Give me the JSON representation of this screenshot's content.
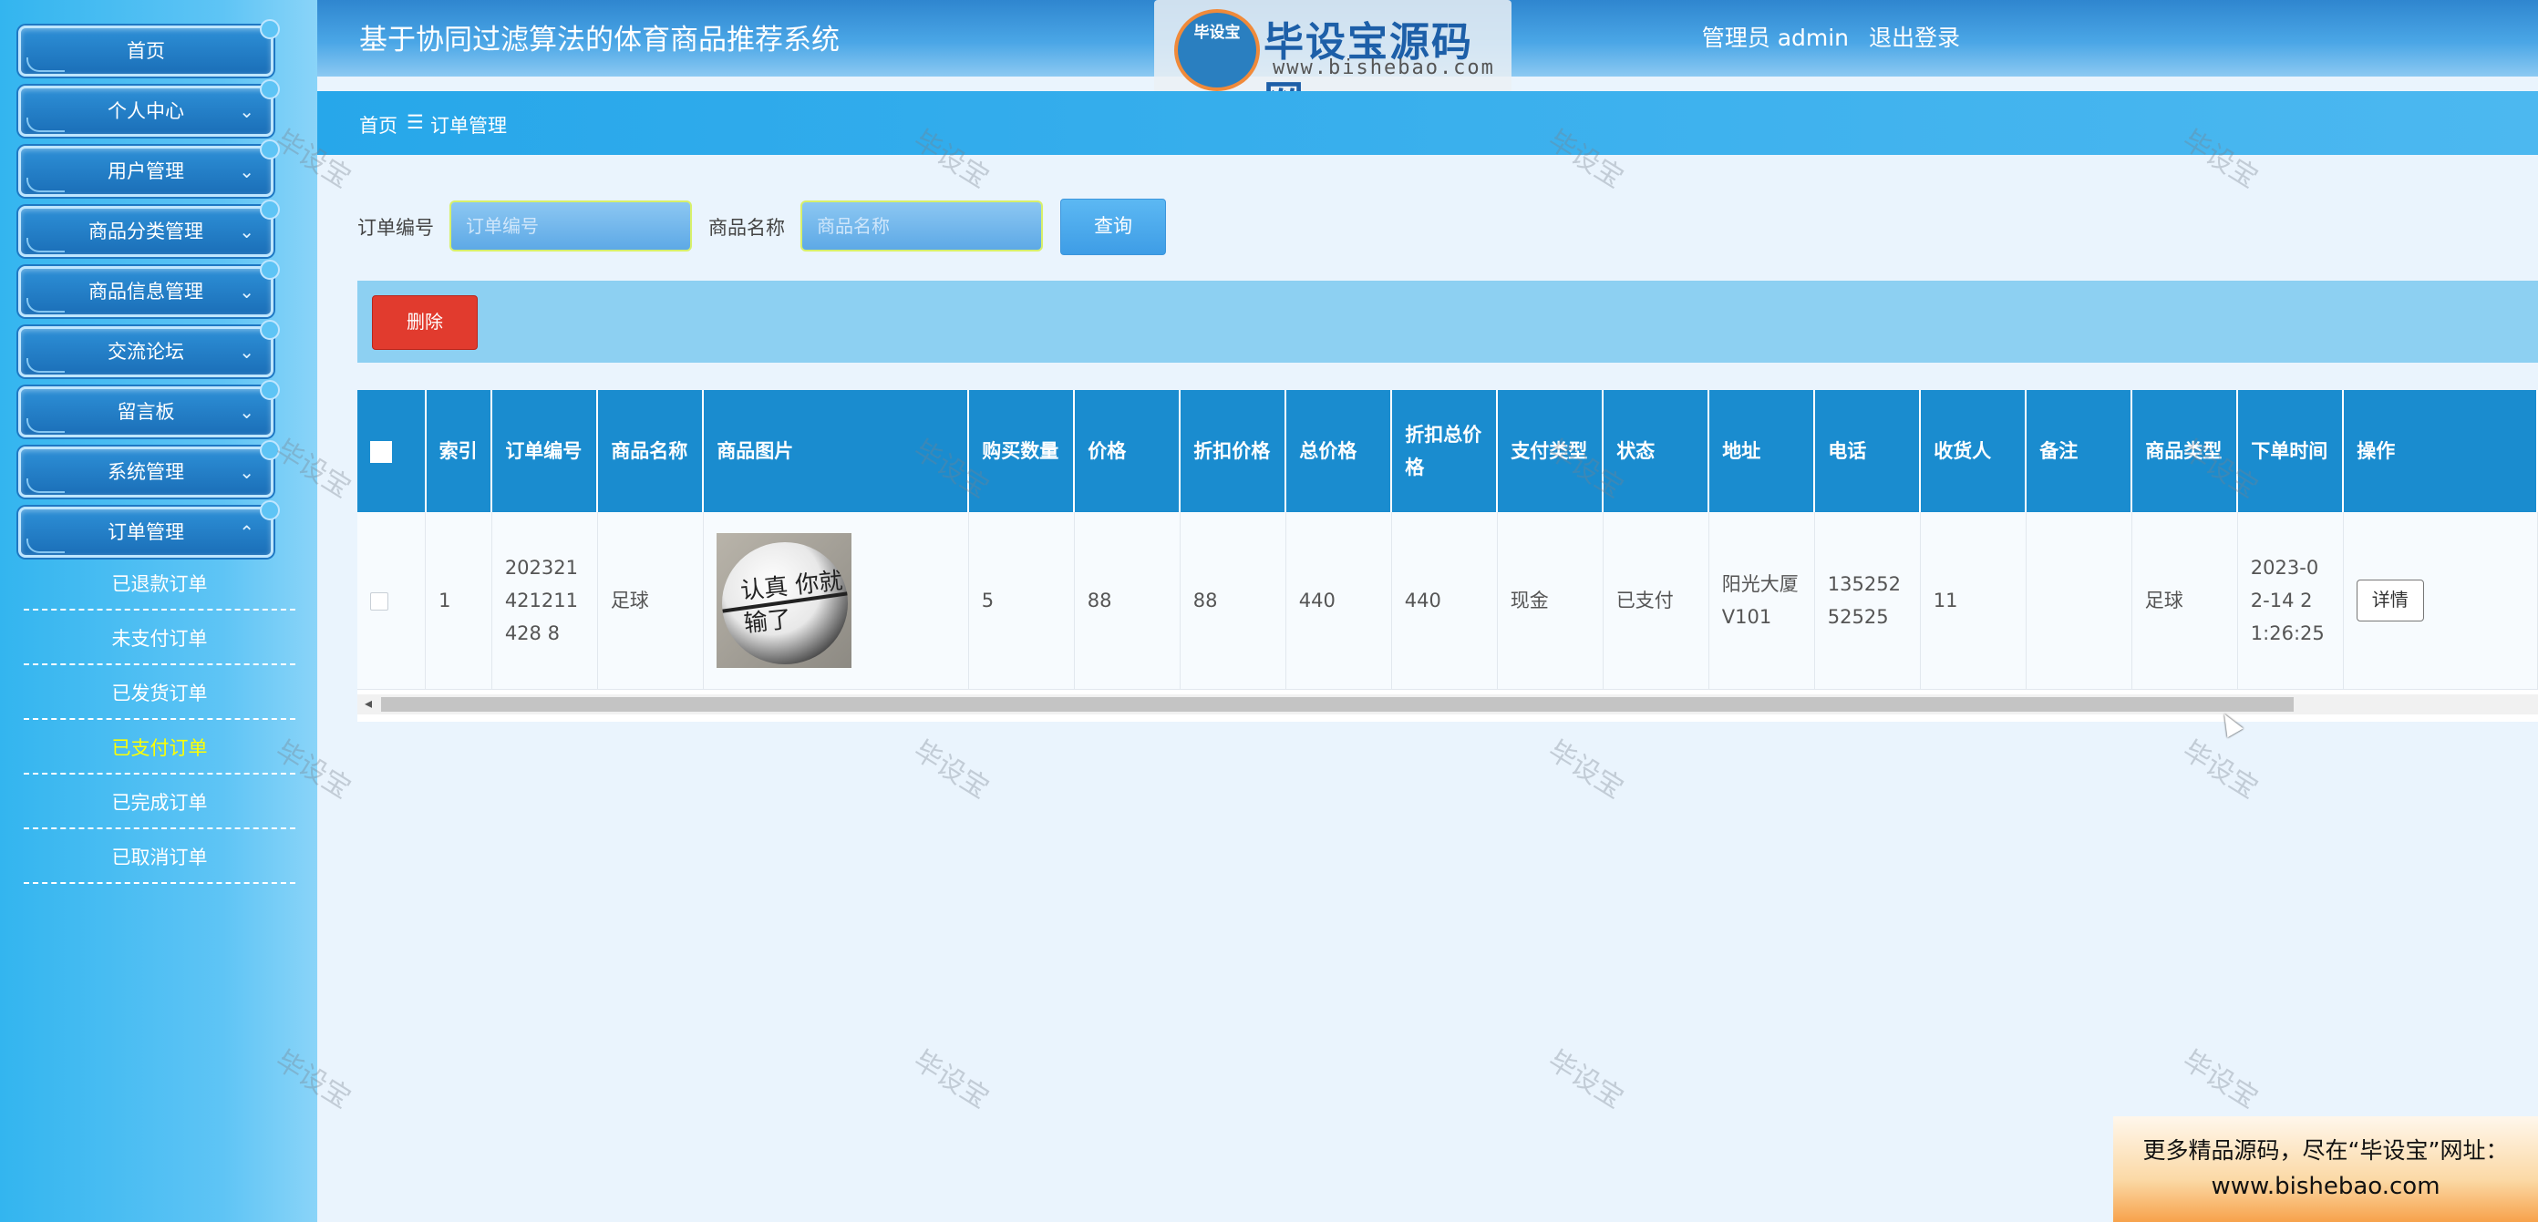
{
  "header": {
    "title": "基于协同过滤算法的体育商品推荐系统",
    "user_role": "管理员 admin",
    "logout": "退出登录"
  },
  "logo": {
    "mascot_text": "毕设宝",
    "brand": "毕设宝源码网",
    "url": "www.bishebao.com"
  },
  "sidebar": {
    "menus": [
      {
        "label": "首页"
      },
      {
        "label": "个人中心"
      },
      {
        "label": "用户管理"
      },
      {
        "label": "商品分类管理"
      },
      {
        "label": "商品信息管理"
      },
      {
        "label": "交流论坛"
      },
      {
        "label": "留言板"
      },
      {
        "label": "系统管理"
      },
      {
        "label": "订单管理"
      }
    ],
    "order_sub": [
      {
        "label": "已退款订单"
      },
      {
        "label": "未支付订单"
      },
      {
        "label": "已发货订单"
      },
      {
        "label": "已支付订单",
        "active": true
      },
      {
        "label": "已完成订单"
      },
      {
        "label": "已取消订单"
      }
    ]
  },
  "breadcrumb": {
    "home": "首页",
    "sep": "☰",
    "current": "订单管理"
  },
  "search": {
    "order_no_label": "订单编号",
    "order_no_placeholder": "订单编号",
    "goods_name_label": "商品名称",
    "goods_name_placeholder": "商品名称",
    "query_button": "查询"
  },
  "actions": {
    "delete_button": "删除"
  },
  "table": {
    "columns": [
      "索引",
      "订单编号",
      "商品名称",
      "商品图片",
      "购买数量",
      "价格",
      "折扣价格",
      "总价格",
      "折扣总价格",
      "支付类型",
      "状态",
      "地址",
      "电话",
      "收货人",
      "备注",
      "商品类型",
      "下单时间",
      "操作"
    ],
    "rows": [
      {
        "index": "1",
        "order_no": "202321421211428 8",
        "goods_name": "足球",
        "goods_image_text": "认真 你就输了",
        "quantity": "5",
        "price": "88",
        "discount_price": "88",
        "total": "440",
        "discount_total": "440",
        "pay_type": "现金",
        "status": "已支付",
        "address": "阳光大厦V101",
        "phone": "13525252525",
        "receiver": "11",
        "remark": "",
        "goods_type": "足球",
        "order_time": "2023-02-14 21:26:25",
        "detail_button": "详情"
      }
    ]
  },
  "watermark": "毕设宝",
  "promo": {
    "line1": "更多精品源码，尽在“毕设宝”网址：",
    "line2": "www.bishebao.com"
  },
  "colors": {
    "sidebar": "#33b5ef",
    "header_blue": "#2f86cf",
    "table_header": "#1a8ccf",
    "delete_red": "#e13b2e",
    "active_sub": "#ffff00"
  }
}
